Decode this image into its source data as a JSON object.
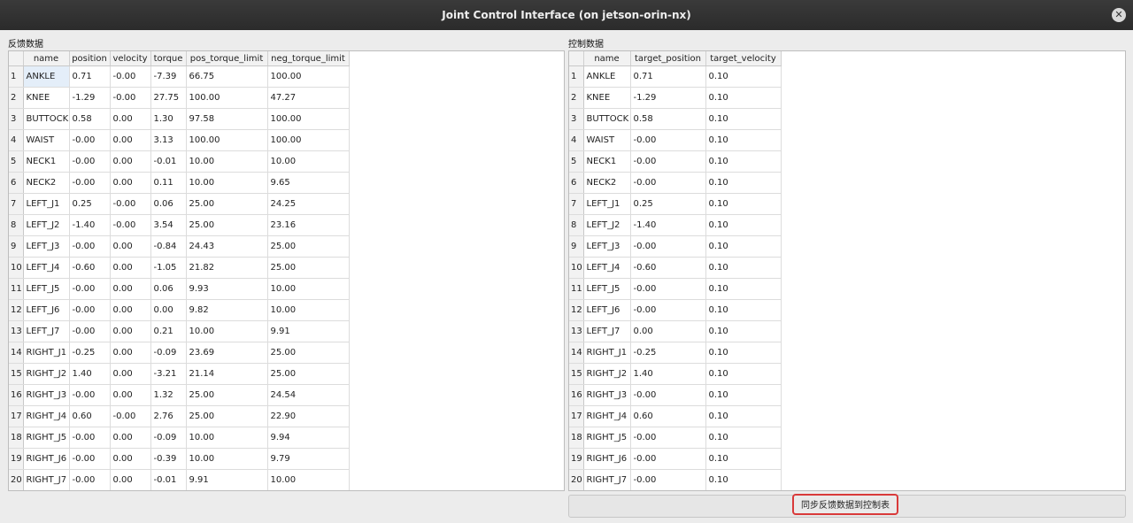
{
  "window": {
    "title": "Joint Control Interface (on jetson-orin-nx)"
  },
  "feedback": {
    "label": "反馈数据",
    "columns": [
      "name",
      "position",
      "velocity",
      "torque",
      "pos_torque_limit",
      "neg_torque_limit"
    ],
    "rows": [
      [
        "ANKLE",
        "0.71",
        "-0.00",
        "-7.39",
        "66.75",
        "100.00"
      ],
      [
        "KNEE",
        "-1.29",
        "-0.00",
        "27.75",
        "100.00",
        "47.27"
      ],
      [
        "BUTTOCK",
        "0.58",
        "0.00",
        "1.30",
        "97.58",
        "100.00"
      ],
      [
        "WAIST",
        "-0.00",
        "0.00",
        "3.13",
        "100.00",
        "100.00"
      ],
      [
        "NECK1",
        "-0.00",
        "0.00",
        "-0.01",
        "10.00",
        "10.00"
      ],
      [
        "NECK2",
        "-0.00",
        "0.00",
        "0.11",
        "10.00",
        "9.65"
      ],
      [
        "LEFT_J1",
        "0.25",
        "-0.00",
        "0.06",
        "25.00",
        "24.25"
      ],
      [
        "LEFT_J2",
        "-1.40",
        "-0.00",
        "3.54",
        "25.00",
        "23.16"
      ],
      [
        "LEFT_J3",
        "-0.00",
        "0.00",
        "-0.84",
        "24.43",
        "25.00"
      ],
      [
        "LEFT_J4",
        "-0.60",
        "0.00",
        "-1.05",
        "21.82",
        "25.00"
      ],
      [
        "LEFT_J5",
        "-0.00",
        "0.00",
        "0.06",
        "9.93",
        "10.00"
      ],
      [
        "LEFT_J6",
        "-0.00",
        "0.00",
        "0.00",
        "9.82",
        "10.00"
      ],
      [
        "LEFT_J7",
        "-0.00",
        "0.00",
        "0.21",
        "10.00",
        "9.91"
      ],
      [
        "RIGHT_J1",
        "-0.25",
        "0.00",
        "-0.09",
        "23.69",
        "25.00"
      ],
      [
        "RIGHT_J2",
        "1.40",
        "0.00",
        "-3.21",
        "21.14",
        "25.00"
      ],
      [
        "RIGHT_J3",
        "-0.00",
        "0.00",
        "1.32",
        "25.00",
        "24.54"
      ],
      [
        "RIGHT_J4",
        "0.60",
        "-0.00",
        "2.76",
        "25.00",
        "22.90"
      ],
      [
        "RIGHT_J5",
        "-0.00",
        "0.00",
        "-0.09",
        "10.00",
        "9.94"
      ],
      [
        "RIGHT_J6",
        "-0.00",
        "0.00",
        "-0.39",
        "10.00",
        "9.79"
      ],
      [
        "RIGHT_J7",
        "-0.00",
        "0.00",
        "-0.01",
        "9.91",
        "10.00"
      ]
    ]
  },
  "control": {
    "label": "控制数据",
    "columns": [
      "name",
      "target_position",
      "target_velocity"
    ],
    "rows": [
      [
        "ANKLE",
        "0.71",
        "0.10"
      ],
      [
        "KNEE",
        "-1.29",
        "0.10"
      ],
      [
        "BUTTOCK",
        "0.58",
        "0.10"
      ],
      [
        "WAIST",
        "-0.00",
        "0.10"
      ],
      [
        "NECK1",
        "-0.00",
        "0.10"
      ],
      [
        "NECK2",
        "-0.00",
        "0.10"
      ],
      [
        "LEFT_J1",
        "0.25",
        "0.10"
      ],
      [
        "LEFT_J2",
        "-1.40",
        "0.10"
      ],
      [
        "LEFT_J3",
        "-0.00",
        "0.10"
      ],
      [
        "LEFT_J4",
        "-0.60",
        "0.10"
      ],
      [
        "LEFT_J5",
        "-0.00",
        "0.10"
      ],
      [
        "LEFT_J6",
        "-0.00",
        "0.10"
      ],
      [
        "LEFT_J7",
        "0.00",
        "0.10"
      ],
      [
        "RIGHT_J1",
        "-0.25",
        "0.10"
      ],
      [
        "RIGHT_J2",
        "1.40",
        "0.10"
      ],
      [
        "RIGHT_J3",
        "-0.00",
        "0.10"
      ],
      [
        "RIGHT_J4",
        "0.60",
        "0.10"
      ],
      [
        "RIGHT_J5",
        "-0.00",
        "0.10"
      ],
      [
        "RIGHT_J6",
        "-0.00",
        "0.10"
      ],
      [
        "RIGHT_J7",
        "-0.00",
        "0.10"
      ]
    ]
  },
  "sync_button": {
    "label": "同步反馈数据到控制表"
  },
  "icons": {
    "close": "close-icon"
  }
}
